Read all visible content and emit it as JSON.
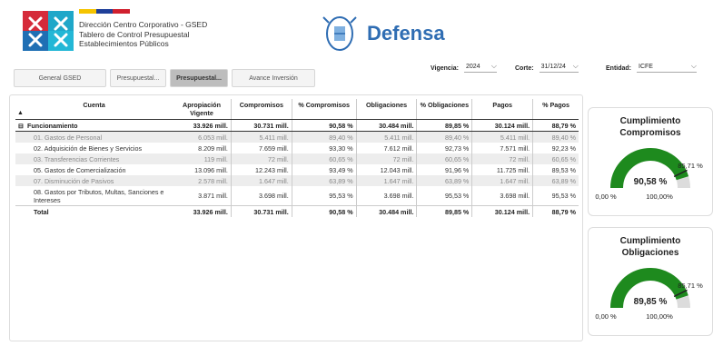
{
  "header": {
    "line1": "Dirección Centro Corporativo - GSED",
    "line2": "Tablero de Control Presupuestal",
    "line3": "Establecimientos Públicos",
    "brand": "Defensa"
  },
  "tabs": [
    {
      "label": "General GSED",
      "active": false
    },
    {
      "label": "Presupuestal...",
      "active": false
    },
    {
      "label": "Presupuestal...",
      "active": true
    },
    {
      "label": "Avance Inversión",
      "active": false
    }
  ],
  "filters": {
    "vigencia": {
      "label": "Vigencia:",
      "value": "2024"
    },
    "corte": {
      "label": "Corte:",
      "value": "31/12/24"
    },
    "entidad": {
      "label": "Entidad:",
      "value": "ICFE"
    }
  },
  "table": {
    "headers": [
      "Cuenta",
      "Apropiación Vigente",
      "Compromisos",
      "% Compromisos",
      "Obligaciones",
      "% Obligaciones",
      "Pagos",
      "% Pagos"
    ],
    "group": {
      "expander": "⊟",
      "name": "Funcionamiento",
      "cells": [
        "33.926 mill.",
        "30.731 mill.",
        "90,58 %",
        "30.484 mill.",
        "89,85 %",
        "30.124 mill.",
        "88,79 %"
      ]
    },
    "rows": [
      {
        "name": "01. Gastos de Personal",
        "cells": [
          "6.053 mill.",
          "5.411 mill.",
          "89,40 %",
          "5.411 mill.",
          "89,40 %",
          "5.411 mill.",
          "89,40 %"
        ],
        "muted": true
      },
      {
        "name": "02. Adquisición de Bienes y Servicios",
        "cells": [
          "8.209 mill.",
          "7.659 mill.",
          "93,30 %",
          "7.612 mill.",
          "92,73 %",
          "7.571 mill.",
          "92,23 %"
        ],
        "muted": false
      },
      {
        "name": "03. Transferencias Corrientes",
        "cells": [
          "119 mill.",
          "72 mill.",
          "60,65 %",
          "72 mill.",
          "60,65 %",
          "72 mill.",
          "60,65 %"
        ],
        "muted": true
      },
      {
        "name": "05. Gastos de Comercialización",
        "cells": [
          "13.096 mill.",
          "12.243 mill.",
          "93,49 %",
          "12.043 mill.",
          "91,96 %",
          "11.725 mill.",
          "89,53 %"
        ],
        "muted": false
      },
      {
        "name": "07. Disminución de Pasivos",
        "cells": [
          "2.578 mill.",
          "1.647 mill.",
          "63,89 %",
          "1.647 mill.",
          "63,89 %",
          "1.647 mill.",
          "63,89 %"
        ],
        "muted": true
      },
      {
        "name": "08. Gastos por Tributos, Multas, Sanciones e Intereses",
        "cells": [
          "3.871 mill.",
          "3.698 mill.",
          "95,53 %",
          "3.698 mill.",
          "95,53 %",
          "3.698 mill.",
          "95,53 %"
        ],
        "muted": false
      }
    ],
    "total": {
      "name": "Total",
      "cells": [
        "33.926 mill.",
        "30.731 mill.",
        "90,58 %",
        "30.484 mill.",
        "89,85 %",
        "30.124 mill.",
        "88,79 %"
      ]
    }
  },
  "gauges": [
    {
      "title_line1": "Cumplimiento",
      "title_line2": "Compromisos",
      "value": 90.58,
      "value_label": "90,58 %",
      "target_label": "85,71 %",
      "target": 85.71,
      "min_label": "0,00 %",
      "max_label": "100,00%",
      "color": "#1e8a1e"
    },
    {
      "title_line1": "Cumplimiento",
      "title_line2": "Obligaciones",
      "value": 89.85,
      "value_label": "89,85 %",
      "target_label": "85,71 %",
      "target": 85.71,
      "min_label": "0,00 %",
      "max_label": "100,00%",
      "color": "#1e8a1e"
    }
  ]
}
